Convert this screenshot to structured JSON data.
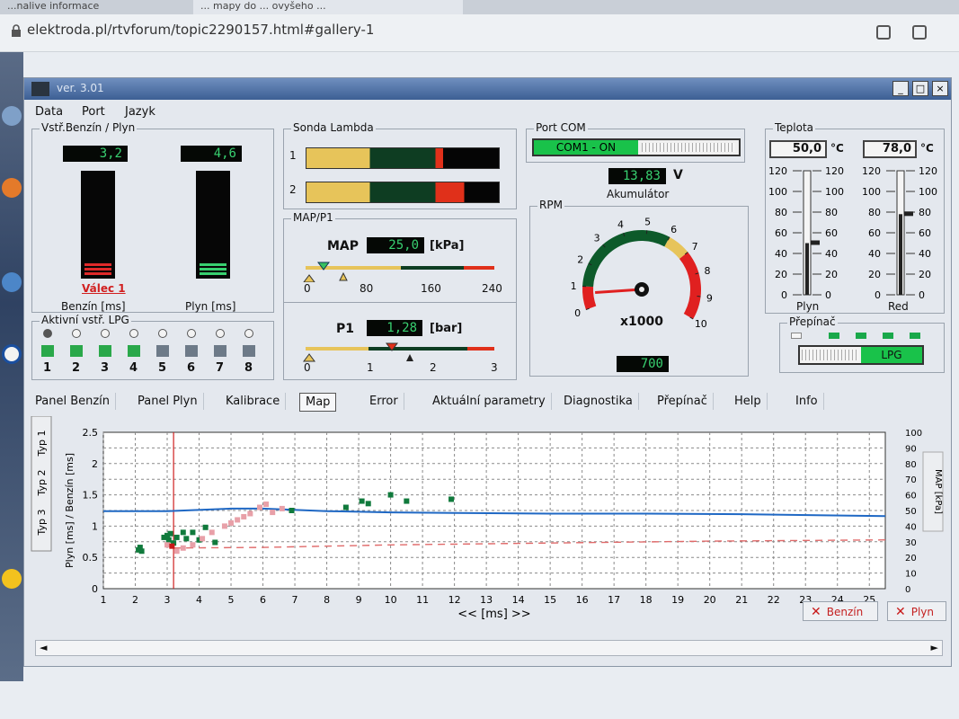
{
  "browser": {
    "tabs": [
      "...nalive informace",
      "... mapy do ... ovyšeho ..."
    ],
    "url": "elektroda.pl/rtvforum/topic2290157.html#gallery-1"
  },
  "app": {
    "title": "ver. 3.01",
    "menu": [
      "Data",
      "Port",
      "Jazyk"
    ],
    "window_buttons": [
      "_",
      "□",
      "×"
    ]
  },
  "injection": {
    "title": "Vstř.Benzín / Plyn",
    "benzin_value": "3,2",
    "plyn_value": "4,6",
    "benzin_label": "Benzín [ms]",
    "plyn_label": "Plyn [ms]",
    "valec_label": "Válec 1"
  },
  "lpg_injectors": {
    "title": "Aktivní vstř. LPG",
    "numbers": [
      "1",
      "2",
      "3",
      "4",
      "5",
      "6",
      "7",
      "8"
    ]
  },
  "lambda": {
    "title": "Sonda Lambda",
    "row_labels": [
      "1",
      "2"
    ]
  },
  "map_p1": {
    "title": "MAP/P1",
    "map_label": "MAP",
    "map_value": "25,0",
    "map_unit": "[kPa]",
    "map_ticks": [
      "0",
      "80",
      "160",
      "240"
    ],
    "p1_label": "P1",
    "p1_value": "1,28",
    "p1_unit": "[bar]",
    "p1_ticks": [
      "0",
      "1",
      "2",
      "3"
    ]
  },
  "port": {
    "title": "Port COM",
    "status": "COM1 - ON"
  },
  "battery": {
    "value": "13,83",
    "unit": "V",
    "label": "Akumulátor"
  },
  "rpm": {
    "title": "RPM",
    "scale": [
      "0",
      "1",
      "2",
      "3",
      "4",
      "5",
      "6",
      "7",
      "8",
      "9",
      "10"
    ],
    "multiplier": "x1000",
    "value": "700"
  },
  "temperature": {
    "title": "Teplota",
    "plyn_value": "50,0",
    "red_value": "78,0",
    "unit": "°C",
    "ticks": [
      "120",
      "100",
      "80",
      "60",
      "40",
      "20",
      "0"
    ],
    "plyn_label": "Plyn",
    "red_label": "Red"
  },
  "switch": {
    "title": "Přepínač",
    "mode": "LPG"
  },
  "tabs": [
    "Panel Benzín",
    "Panel Plyn",
    "Kalibrace",
    "Map",
    "Error",
    "Aktuální parametry",
    "Diagnostika",
    "Přepínač",
    "Help",
    "Info"
  ],
  "map_side_tabs": [
    "Typ 1",
    "Typ 2",
    "Typ 3"
  ],
  "buttons": {
    "benzin": "Benzín",
    "plyn": "Plyn"
  },
  "colors": {
    "lcd_green": "#38d070",
    "bar_green": "#0d6b35",
    "bar_yellow": "#e7c45a",
    "bar_red": "#e0301a",
    "chart_blue": "#1f68c4"
  },
  "chart_data": {
    "type": "scatter",
    "xlabel": "<< [ms] >>",
    "ylabel": "Plyn [ms] / Benzín [ms]",
    "y2label": "MAP [kPa]",
    "xlim": [
      1,
      25.5
    ],
    "ylim": [
      0,
      2.5
    ],
    "y2lim": [
      0,
      100
    ],
    "x_ticks": [
      1,
      2,
      3,
      4,
      5,
      6,
      7,
      8,
      9,
      10,
      11,
      12,
      13,
      14,
      15,
      16,
      17,
      18,
      19,
      20,
      21,
      22,
      23,
      24,
      25
    ],
    "y_ticks": [
      0,
      0.5,
      1,
      1.5,
      2,
      2.5
    ],
    "y2_ticks": [
      0,
      10,
      20,
      30,
      40,
      50,
      60,
      70,
      80,
      90,
      100
    ],
    "grid": true,
    "cursor_x": 3.2,
    "series": [
      {
        "kind": "line",
        "color": "#1f68c4",
        "x": [
          1,
          3,
          5,
          6,
          8,
          10,
          12,
          15,
          18,
          21,
          25.5
        ],
        "y": [
          1.24,
          1.24,
          1.28,
          1.28,
          1.24,
          1.22,
          1.21,
          1.2,
          1.2,
          1.19,
          1.16
        ]
      },
      {
        "kind": "dashed",
        "color": "#e06a6a",
        "x": [
          3.2,
          6,
          10,
          15,
          20,
          25.5
        ],
        "y": [
          0.65,
          0.66,
          0.7,
          0.73,
          0.76,
          0.78
        ]
      },
      {
        "kind": "points",
        "color": "#107a3c",
        "x": [
          2.1,
          2.15,
          2.2,
          2.9,
          3.0,
          3.05,
          3.1,
          3.2,
          3.3,
          3.5,
          3.6,
          3.8,
          4.0,
          4.2,
          4.5,
          6.9,
          8.6,
          9.1,
          9.3,
          10.0,
          10.5,
          11.9
        ],
        "y": [
          0.62,
          0.66,
          0.6,
          0.82,
          0.85,
          0.78,
          0.88,
          0.73,
          0.82,
          0.9,
          0.8,
          0.9,
          0.78,
          0.98,
          0.74,
          1.25,
          1.3,
          1.4,
          1.36,
          1.5,
          1.4,
          1.43
        ]
      },
      {
        "kind": "points",
        "color": "#e8a0a8",
        "x": [
          3.0,
          3.3,
          3.5,
          3.8,
          4.1,
          4.4,
          4.8,
          5.0,
          5.2,
          5.4,
          5.6,
          5.9,
          6.1,
          6.3,
          6.6
        ],
        "y": [
          0.7,
          0.6,
          0.65,
          0.7,
          0.8,
          0.9,
          1.0,
          1.05,
          1.1,
          1.15,
          1.2,
          1.3,
          1.35,
          1.22,
          1.28
        ]
      },
      {
        "kind": "points",
        "color": "#c81818",
        "x": [
          3.15
        ],
        "y": [
          0.68
        ]
      }
    ]
  }
}
